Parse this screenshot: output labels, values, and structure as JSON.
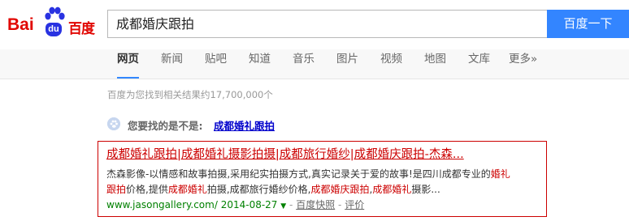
{
  "header": {
    "logo": {
      "text_latin": "Bai",
      "text_badge": "du",
      "text_cn": "百度"
    },
    "search": {
      "query": "成都婚庆跟拍",
      "button_label": "百度一下"
    }
  },
  "nav": {
    "items": [
      {
        "label": "网页",
        "active": true
      },
      {
        "label": "新闻"
      },
      {
        "label": "贴吧"
      },
      {
        "label": "知道"
      },
      {
        "label": "音乐"
      },
      {
        "label": "图片"
      },
      {
        "label": "视频"
      },
      {
        "label": "地图"
      },
      {
        "label": "文库"
      },
      {
        "label": "更多»"
      }
    ]
  },
  "results_info": {
    "count_text": "百度为您找到相关结果约17,700,000个"
  },
  "suggestion": {
    "label": "您要找的是不是:",
    "link": "成都婚礼跟拍"
  },
  "result": {
    "title": "成都婚礼跟拍|成都婚礼摄影拍摄|成都旅行婚纱|成都婚庆跟拍-杰森...",
    "abstract_line1_a": "杰森影像-以情感和故事拍摄,采用纪实拍摄方式,真实记录关于爱的故事!是四川成都专业的",
    "abstract_line1_hl": "婚礼",
    "abstract_line2_hl1": "跟拍",
    "abstract_line2_a": "价格,提供",
    "abstract_line2_hl2": "成都婚礼",
    "abstract_line2_b": "拍摄,成都旅行婚纱价格,",
    "abstract_line2_hl3": "成都婚庆跟拍",
    "abstract_line2_c": ",",
    "abstract_line2_hl4": "成都婚礼",
    "abstract_line2_d": "摄影...",
    "url": "www.jasongallery.com/",
    "date": "2014-08-27",
    "arrow": "▼",
    "snapshot": "百度快照",
    "separator": "-",
    "review": "评价"
  },
  "colors": {
    "brand_red": "#e10601",
    "brand_blue": "#2932e1",
    "button_blue": "#3385ff",
    "link_blue": "#0000cc",
    "highlight_red": "#cc0000",
    "url_green": "#008000"
  }
}
